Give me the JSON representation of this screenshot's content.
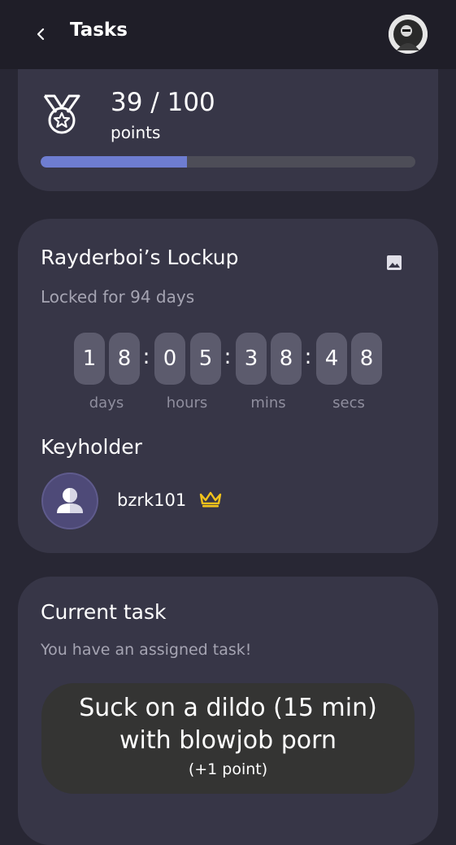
{
  "header": {
    "back_icon": "chevron-left-icon",
    "title": "Tasks",
    "avatar_icon": "user-avatar-icon"
  },
  "points": {
    "icon": "medal-icon",
    "value": "39 / 100",
    "label": "points",
    "progress_fraction": 0.39,
    "bar_color": "#6e7dd1"
  },
  "lock": {
    "name": "Rayderboi’s Lockup",
    "image_icon": "image-icon",
    "locked_for": "Locked for 94 days",
    "timer": {
      "digits": [
        "1",
        "8",
        "0",
        "5",
        "3",
        "8",
        "4",
        "8"
      ],
      "separator": ":",
      "units": [
        "days",
        "hours",
        "mins",
        "secs"
      ]
    }
  },
  "keyholder": {
    "heading": "Keyholder",
    "name": "bzrk101",
    "crown_icon": "crown-icon",
    "crown_color": "#f1c21b"
  },
  "task": {
    "heading": "Current task",
    "subtitle": "You have an assigned task!",
    "text_line1": "Suck on a dildo (15 min)",
    "text_line2": "with blowjob porn",
    "points": "(+1 point)"
  }
}
